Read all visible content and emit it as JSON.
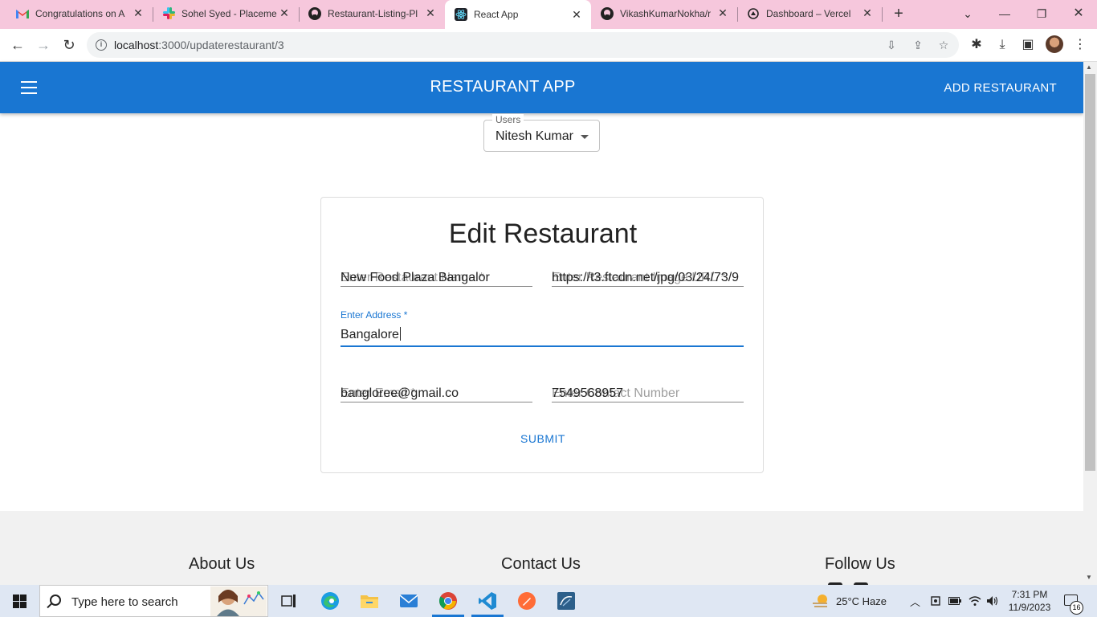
{
  "browser": {
    "tabs": [
      {
        "title": "Congratulations on A",
        "icon": "gmail-icon"
      },
      {
        "title": "Sohel Syed - Placeme",
        "icon": "slack-icon"
      },
      {
        "title": "Restaurant-Listing-Pl",
        "icon": "github-icon"
      },
      {
        "title": "React App",
        "icon": "react-icon",
        "active": true
      },
      {
        "title": "VikashKumarNokha/r",
        "icon": "github-icon"
      },
      {
        "title": "Dashboard – Vercel",
        "icon": "vercel-icon"
      }
    ],
    "url": {
      "host": "localhost",
      "path": ":3000/updaterestaurant/3"
    }
  },
  "appbar": {
    "title": "RESTAURANT APP",
    "add_button": "ADD RESTAURANT",
    "color": "#1976d2"
  },
  "users_select": {
    "label": "Users",
    "value": "Nitesh Kumar"
  },
  "form": {
    "title": "Edit Restaurant",
    "name": {
      "placeholder": "Enter Restaurant Name *",
      "value": "New Food Plaza Bangalor"
    },
    "image": {
      "placeholder": "Enter Restaurant Image URL *",
      "value": "https://t3.ftcdn.net/jpg/03/24/73/9"
    },
    "address": {
      "label": "Enter Address *",
      "value": "Bangalore"
    },
    "email": {
      "placeholder": "Enter Email *",
      "value": "bangloree@gmail.co"
    },
    "phone": {
      "placeholder": "Enter Contact Number",
      "value": "7549568957"
    },
    "submit": "SUBMIT"
  },
  "footer": {
    "about": "About Us",
    "contact": "Contact Us",
    "follow": "Follow Us"
  },
  "taskbar": {
    "search_placeholder": "Type here to search",
    "weather": "25°C  Haze",
    "time": "7:31 PM",
    "date": "11/9/2023",
    "notifications": "16"
  }
}
